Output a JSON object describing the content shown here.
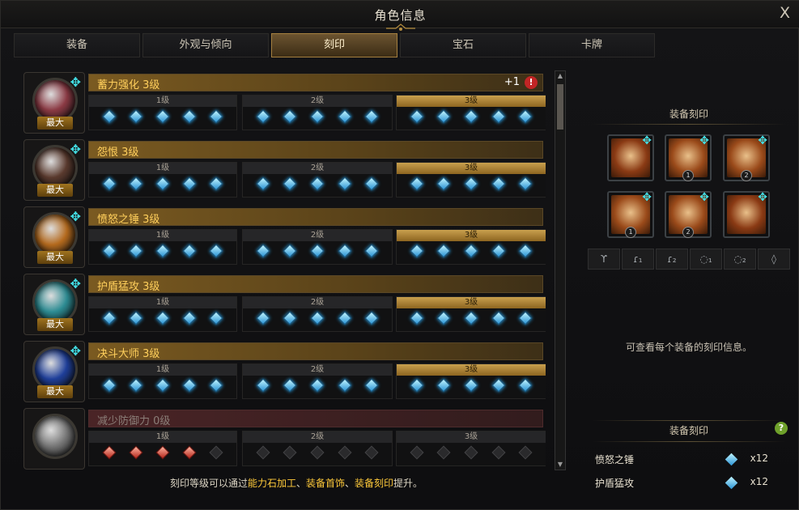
{
  "window": {
    "title": "角色信息",
    "close": "X"
  },
  "tabs": [
    {
      "label": "装备"
    },
    {
      "label": "外观与倾向"
    },
    {
      "label": "刻印",
      "active": true
    },
    {
      "label": "宝石"
    },
    {
      "label": "卡牌"
    }
  ],
  "engravings": [
    {
      "name": "蓄力强化 3级",
      "badge": "最大",
      "bonus": "+1",
      "alert": "!",
      "orb_color": "#8b3a44",
      "active": true,
      "levels": [
        {
          "label": "1级",
          "gems": [
            "blue",
            "blue",
            "blue",
            "blue",
            "blue"
          ]
        },
        {
          "label": "2级",
          "gems": [
            "blue",
            "blue",
            "blue",
            "blue",
            "blue"
          ]
        },
        {
          "label": "3级",
          "gems": [
            "blue",
            "blue",
            "blue",
            "blue",
            "blue"
          ],
          "current": true
        }
      ]
    },
    {
      "name": "怨恨 3级",
      "badge": "最大",
      "orb_color": "#5a3a2e",
      "active": true,
      "levels": [
        {
          "label": "1级",
          "gems": [
            "blue",
            "blue",
            "blue",
            "blue",
            "blue"
          ]
        },
        {
          "label": "2级",
          "gems": [
            "blue",
            "blue",
            "blue",
            "blue",
            "blue"
          ]
        },
        {
          "label": "3级",
          "gems": [
            "blue",
            "blue",
            "blue",
            "blue",
            "blue"
          ],
          "current": true
        }
      ]
    },
    {
      "name": "愤怒之锤 3级",
      "badge": "最大",
      "orb_color": "#b46a1e",
      "active": true,
      "levels": [
        {
          "label": "1级",
          "gems": [
            "blue",
            "blue",
            "blue",
            "blue",
            "blue"
          ]
        },
        {
          "label": "2级",
          "gems": [
            "blue",
            "blue",
            "blue",
            "blue",
            "blue"
          ]
        },
        {
          "label": "3级",
          "gems": [
            "blue",
            "blue",
            "blue",
            "blue",
            "blue"
          ],
          "current": true
        }
      ]
    },
    {
      "name": "护盾猛攻 3级",
      "badge": "最大",
      "orb_color": "#2d8c93",
      "active": true,
      "levels": [
        {
          "label": "1级",
          "gems": [
            "blue",
            "blue",
            "blue",
            "blue",
            "blue"
          ]
        },
        {
          "label": "2级",
          "gems": [
            "blue",
            "blue",
            "blue",
            "blue",
            "blue"
          ]
        },
        {
          "label": "3级",
          "gems": [
            "blue",
            "blue",
            "blue",
            "blue",
            "blue"
          ],
          "current": true
        }
      ]
    },
    {
      "name": "决斗大师 3级",
      "badge": "最大",
      "orb_color": "#1f3f9a",
      "active": true,
      "levels": [
        {
          "label": "1级",
          "gems": [
            "blue",
            "blue",
            "blue",
            "blue",
            "blue"
          ]
        },
        {
          "label": "2级",
          "gems": [
            "blue",
            "blue",
            "blue",
            "blue",
            "blue"
          ]
        },
        {
          "label": "3级",
          "gems": [
            "blue",
            "blue",
            "blue",
            "blue",
            "blue"
          ],
          "current": true
        }
      ]
    },
    {
      "name": "减少防御力 0级",
      "orb_color": "#777777",
      "active": false,
      "levels": [
        {
          "label": "1级",
          "gems": [
            "red",
            "red",
            "red",
            "red",
            "empty"
          ]
        },
        {
          "label": "2级",
          "gems": [
            "empty",
            "empty",
            "empty",
            "empty",
            "empty"
          ]
        },
        {
          "label": "3级",
          "gems": [
            "empty",
            "empty",
            "empty",
            "empty",
            "empty"
          ]
        }
      ]
    }
  ],
  "footer": {
    "prefix": "刻印等级可以通过",
    "hl1": "能力石加工",
    "sep1": "、",
    "hl2": "装备首饰",
    "sep2": "、",
    "hl3": "装备刻印",
    "suffix": "提升。"
  },
  "equip_section": {
    "title": "装备刻印",
    "slots": [
      {
        "name": "necklace",
        "color": "#8a3a14",
        "num": ""
      },
      {
        "name": "earring-1",
        "color": "#9a4a1a",
        "num": "1"
      },
      {
        "name": "earring-2",
        "color": "#9a4a1a",
        "num": "2"
      },
      {
        "name": "ring-1",
        "color": "#9a4a1a",
        "num": "1"
      },
      {
        "name": "ring-2",
        "color": "#9a4a1a",
        "num": "2"
      },
      {
        "name": "ability-stone",
        "color": "#8a3a14",
        "num": ""
      }
    ],
    "filters": [
      "necklace-icon",
      "earring-1-icon",
      "earring-2-icon",
      "ring-1-icon",
      "ring-2-icon",
      "stone-icon"
    ],
    "info": "可查看每个装备的刻印信息。"
  },
  "summary": {
    "title": "装备刻印",
    "help": "?",
    "rows": [
      {
        "name": "愤怒之锤",
        "count": "x12"
      },
      {
        "name": "护盾猛攻",
        "count": "x12"
      }
    ]
  },
  "colors": {
    "accent": "#ffca3a",
    "gem": "#2a93d4",
    "active_tab": "#6c5430"
  }
}
